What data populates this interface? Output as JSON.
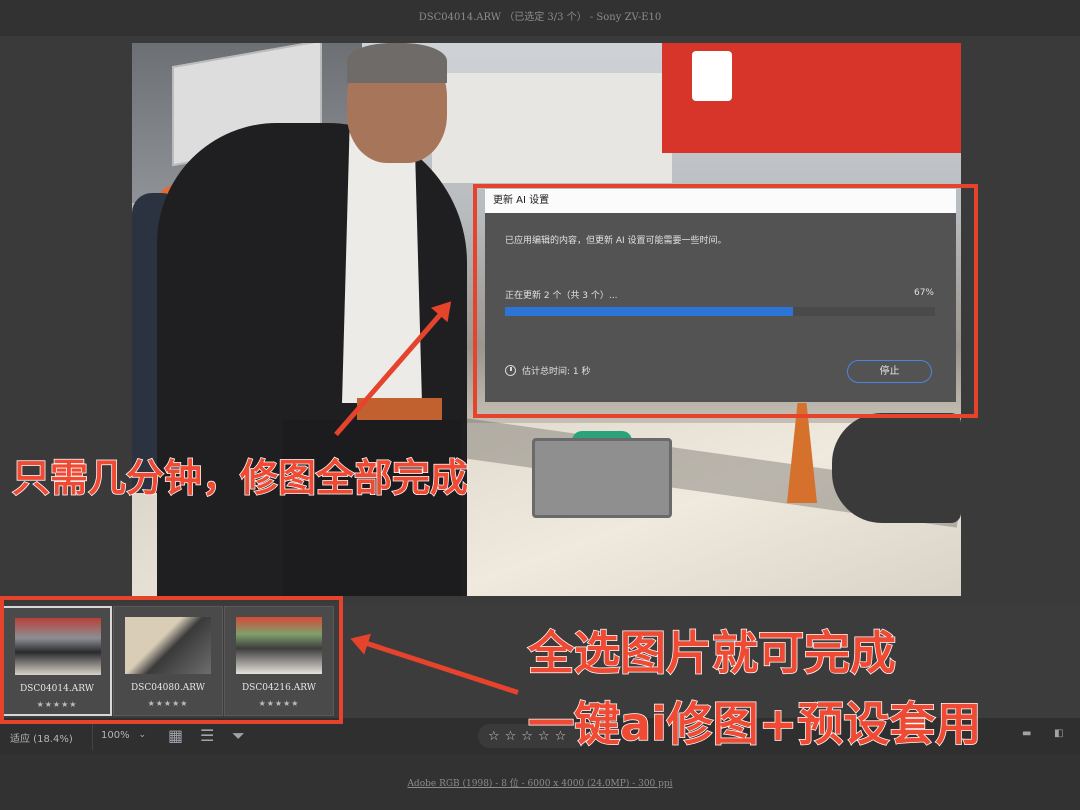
{
  "window": {
    "title": "DSC04014.ARW （已选定 3/3 个） -  Sony ZV-E10"
  },
  "dialog": {
    "title": "更新 AI 设置",
    "message": "已应用编辑的内容，但更新 AI 设置可能需要一些时间。",
    "status": "正在更新 2 个（共 3 个）...",
    "percent_text": "67%",
    "progress": 0.67,
    "time_label": "估计总时间: 1 秒",
    "stop_label": "停止",
    "accent_color": "#2d74d8"
  },
  "annotations": {
    "caption_top": "只需几分钟，修图全部完成",
    "caption_line1": "全选图片就可完成",
    "caption_line2": "一键ai修图+预设套用",
    "highlight_color": "#e5432c"
  },
  "filmstrip": {
    "items": [
      {
        "name": "DSC04014.ARW",
        "stars": "★★★★★",
        "selected": true
      },
      {
        "name": "DSC04080.ARW",
        "stars": "★★★★★",
        "selected": false
      },
      {
        "name": "DSC04216.ARW",
        "stars": "★★★★★",
        "selected": false
      }
    ]
  },
  "toolbar": {
    "zoom_fit": "适应 (18.4%)",
    "zoom_100": "100%",
    "rating_stars": "☆☆☆☆☆",
    "icons": [
      "photo-layout-icon",
      "sort-icon",
      "filter-icon",
      "panel-icon",
      "compare-icon"
    ]
  },
  "status": {
    "text": "Adobe RGB (1998) - 8 位 - 6000 x 4000 (24.0MP) - 300 ppi"
  }
}
